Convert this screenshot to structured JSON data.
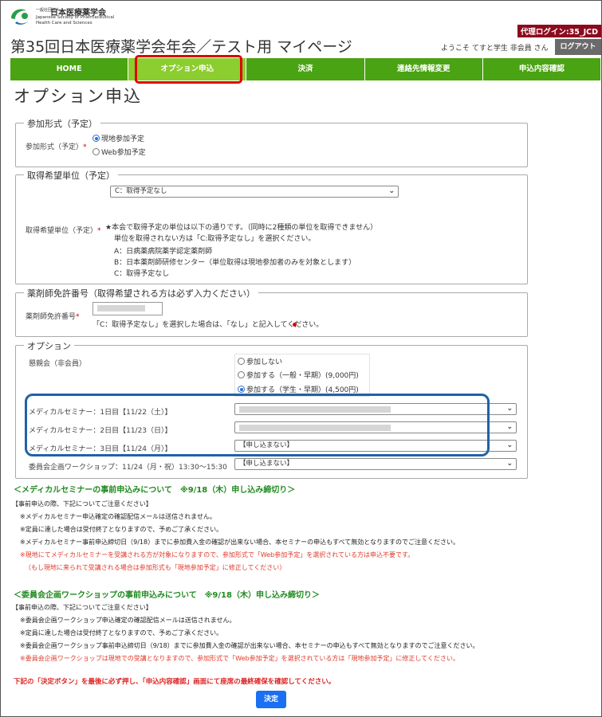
{
  "header": {
    "logo_small": "一般社団法人",
    "logo_name": "日本医療薬学会",
    "logo_en": "Japanese Society of Pharmaceutical Health Care and Sciences",
    "proxy_login": "代理ログイン:35_JCD",
    "page_title": "第35回日本医療薬学会年会／テスト用 マイページ",
    "welcome": "ようこそ てすと学生 非会員 さん",
    "logout_label": "ログアウト"
  },
  "nav": {
    "items": [
      {
        "label": "HOME"
      },
      {
        "label": "オプション申込"
      },
      {
        "label": "決済"
      },
      {
        "label": "連絡先情報変更"
      },
      {
        "label": "申込内容確認"
      }
    ],
    "active_index": 1
  },
  "page": {
    "heading": "オプション申込"
  },
  "participation": {
    "legend": "参加形式（予定）",
    "label": "参加形式（予定）",
    "required_mark": "*",
    "options": [
      "現地参加予定",
      "Web参加予定"
    ],
    "selected_index": 0
  },
  "credits": {
    "legend": "取得希望単位（予定）",
    "label": "取得希望単位（予定）",
    "required_mark": "*",
    "selected": "C：取得予定なし",
    "notes": [
      "★本会で取得予定の単位は以下の通りです。（同時に2種類の単位を取得できません）",
      "単位を取得されない方は「C:取得予定なし」を選択ください。",
      "A：日病薬病院薬学認定薬剤師",
      "B：日本薬剤師研修センター（単位取得は現地参加者のみを対象とします）",
      "C：取得予定なし"
    ]
  },
  "license": {
    "legend": "薬剤師免許番号（取得希望される方は必ず入力ください）",
    "label": "薬剤師免許番号",
    "required_mark": "*",
    "note": "「C：取得予定なし」を選択した場合は、「なし」と記入してください。"
  },
  "options": {
    "legend": "オプション",
    "party_label": "懇親会（非会員）",
    "party_options": [
      "参加しない",
      "参加する（一般・早期）(9,000円)",
      "参加する（学生・早期）(4,500円)"
    ],
    "party_selected_index": 2,
    "rows": [
      {
        "label": "メディカルセミナー：1日目【11/22（土）】",
        "value": ""
      },
      {
        "label": "メディカルセミナー：2日目【11/23（日）】",
        "value": ""
      },
      {
        "label": "メディカルセミナー：3日目【11/24（月）】",
        "value": "【申し込まない】"
      },
      {
        "label": "委員会企画ワークショップ：11/24（月・祝）13:30〜15:30",
        "value": "【申し込まない】"
      }
    ]
  },
  "seminar_notice": {
    "heading": "＜メディカルセミナーの事前申込みについて　※9/18（木）申し込み締切り＞",
    "lines": [
      {
        "text": "【事前申込の際、下記についてご注意ください】",
        "red": false
      },
      {
        "text": "※メディカルセミナー申込確定の確認配信メールは送信されません。",
        "red": false
      },
      {
        "text": "※定員に達した場合は受付終了となりますので、予めご了承ください。",
        "red": false
      },
      {
        "text": "※メディカルセミナー事前申込締切日（9/18）までに参加費入金の確認が出来ない場合、本セミナーの申込もすべて無効となりますのでご注意ください。",
        "red": false
      },
      {
        "text": "※現地にてメディカルセミナーを受講される方が対象になりますので、参加形式で「Web参加予定」を選択されている方は申込不要です。",
        "red": true
      },
      {
        "text": "（もし現地に来られて受講される場合は参加形式も「現地参加予定」に修正してください）",
        "red": true
      }
    ]
  },
  "workshop_notice": {
    "heading": "＜委員会企画ワークショップの事前申込みについて　※9/18（木）申し込み締切り＞",
    "lines": [
      {
        "text": "【事前申込の際、下記についてご注意ください】",
        "red": false
      },
      {
        "text": "※委員会企画ワークショップ申込確定の確認配信メールは送信されません。",
        "red": false
      },
      {
        "text": "※定員に達した場合は受付終了となりますので、予めご了承ください。",
        "red": false
      },
      {
        "text": "※委員会企画ワークショップ事前申込締切日（9/18）までに参加費入金の確認が出来ない場合、本セミナーの申込もすべて無効となりますのでご注意ください。",
        "red": false
      },
      {
        "text": "※委員会企画ワークショップは現地での受講となりますので、参加形式で「Web参加予定」を選択されている方は「現地参加予定」に修正してください。",
        "red": true
      }
    ]
  },
  "footer": {
    "instruction": "下記の「決定ボタン」を最後に必ず押し、「申込内容確認」画面にて座席の最終確保を確認してください。",
    "submit_label": "決定"
  },
  "colors": {
    "nav_green": "#4aa312",
    "nav_active": "#8ccd2f",
    "highlight_red": "#e00000",
    "highlight_blue": "#1f63a6",
    "submit_blue": "#1a6ff2"
  }
}
